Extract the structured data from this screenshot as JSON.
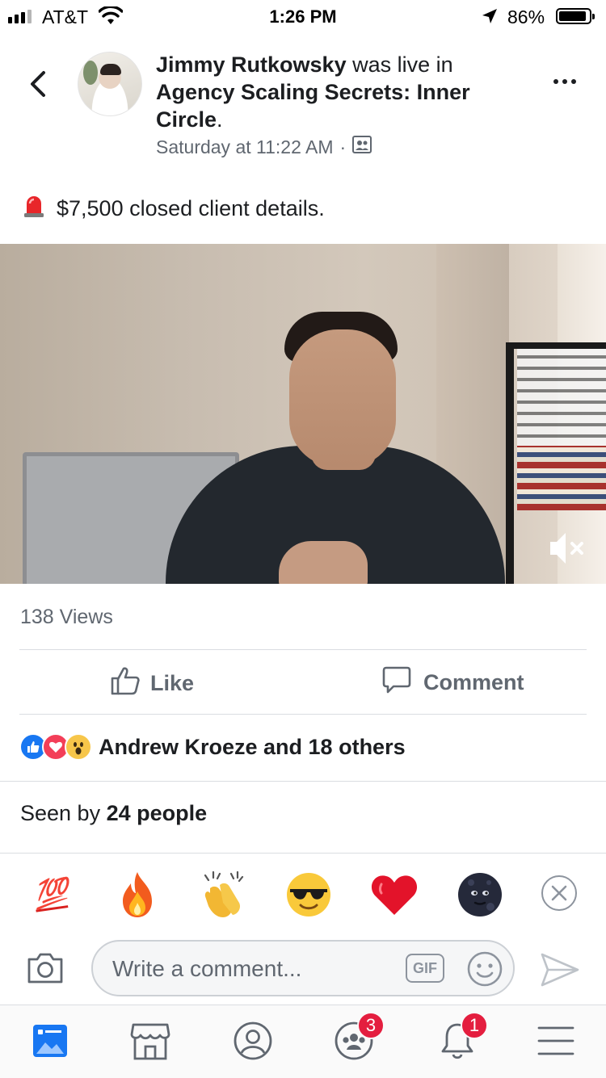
{
  "status_bar": {
    "carrier": "AT&T",
    "time": "1:26 PM",
    "battery": "86%"
  },
  "post": {
    "author": "Jimmy Rutkowsky",
    "action": "was live in",
    "group": "Agency Scaling Secrets: Inner Circle",
    "period": ".",
    "timestamp": "Saturday at 11:22 AM",
    "separator": "·",
    "caption": "$7,500 closed client details.",
    "views": "138 Views"
  },
  "actions": {
    "like_label": "Like",
    "comment_label": "Comment"
  },
  "reactions": {
    "summary": "Andrew Kroeze and 18 others",
    "types": [
      "like-icon",
      "love-icon",
      "wow-icon"
    ]
  },
  "seen": {
    "prefix": "Seen by",
    "count": "24 people"
  },
  "quick_reactions": {
    "items": [
      "💯",
      "🔥",
      "👏",
      "😎",
      "❤️",
      "🌚"
    ]
  },
  "composer": {
    "placeholder": "Write a comment...",
    "gif_label": "GIF"
  },
  "tabbar": {
    "groups_badge": "3",
    "notifications_badge": "1"
  },
  "colors": {
    "accent": "#1877f2",
    "badge": "#e41e3f",
    "text_secondary": "#606770"
  }
}
